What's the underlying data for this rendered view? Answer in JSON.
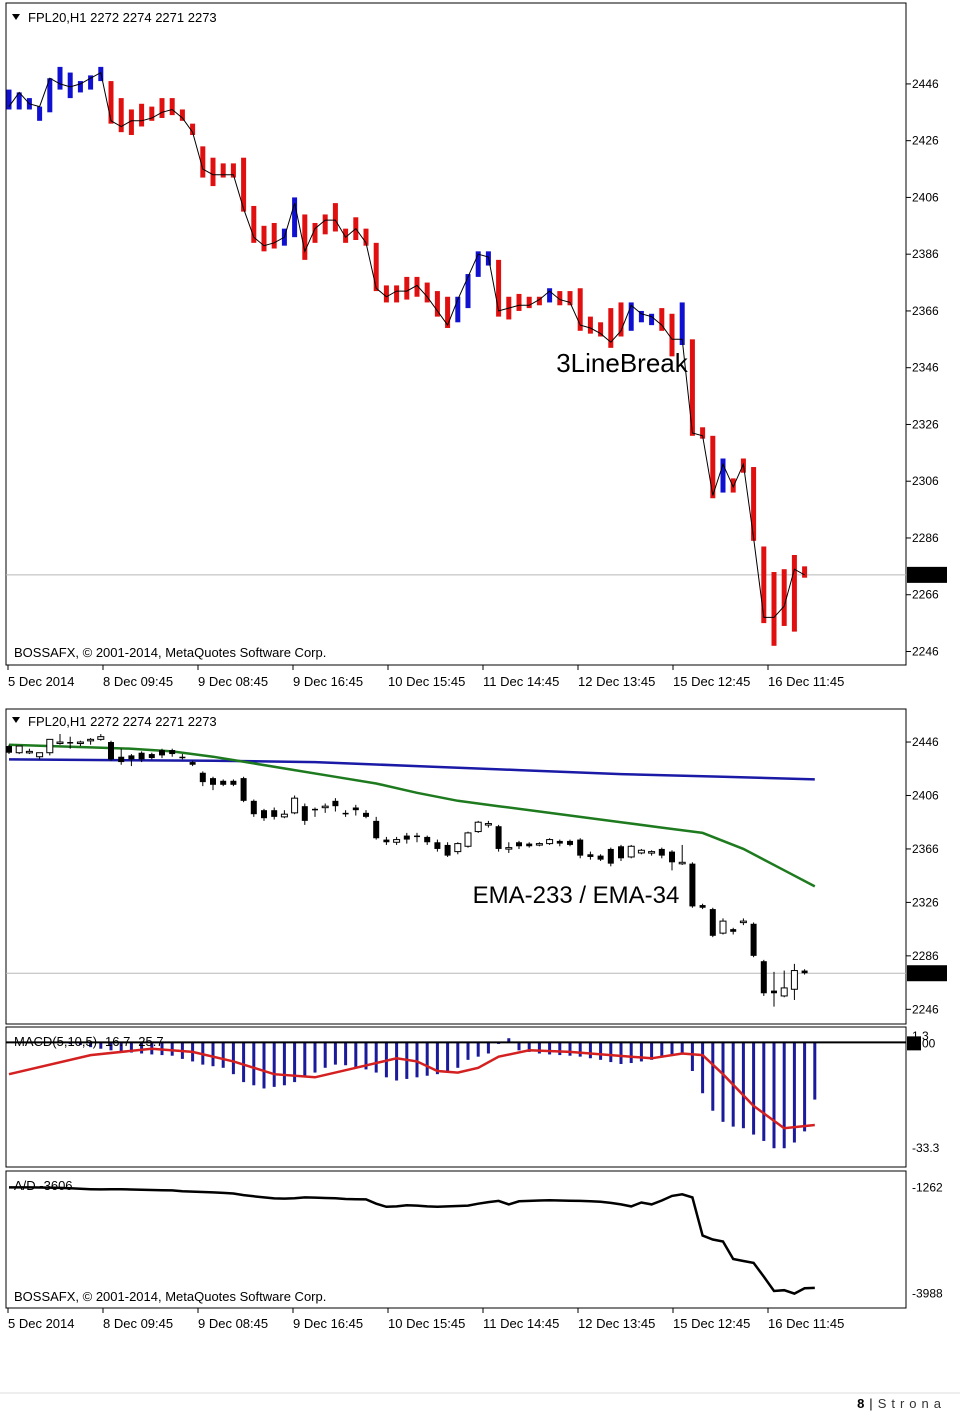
{
  "chart_data": [
    {
      "type": "candlestick",
      "panel": "top",
      "header": "FPL20,H1  2272 2274 2271 2273",
      "annotation": "3LineBreak",
      "copyright": "BOSSAFX, © 2001-2014, MetaQuotes Software Corp.",
      "price_axis_ticks": [
        "2446",
        "2426",
        "2406",
        "2386",
        "2366",
        "2346",
        "2326",
        "2306",
        "2286",
        "2266",
        "2246"
      ],
      "current_price_label": "2273",
      "current_price": 2273,
      "ylim": [
        2243,
        2465
      ],
      "time_labels": [
        "5 Dec 2014",
        "8 Dec 09:45",
        "9 Dec 08:45",
        "9 Dec 16:45",
        "10 Dec 15:45",
        "11 Dec 14:45",
        "12 Dec 13:45",
        "15 Dec 12:45",
        "16 Dec 11:45"
      ],
      "colors": {
        "up": "#1010d0",
        "down": "#e01010",
        "close_line": "#000000"
      },
      "bars": [
        [
          2443,
          2444,
          2437,
          2438,
          "up"
        ],
        [
          2438,
          2443,
          2437,
          2443,
          "up"
        ],
        [
          2439,
          2441,
          2437,
          2439,
          "up"
        ],
        [
          2435,
          2438,
          2433,
          2438,
          "up"
        ],
        [
          2438,
          2448,
          2436,
          2448,
          "up"
        ],
        [
          2446,
          2452,
          2444,
          2446,
          "up"
        ],
        [
          2446,
          2450,
          2441,
          2445,
          "up"
        ],
        [
          2445,
          2447,
          2443,
          2446,
          "up"
        ],
        [
          2447,
          2449,
          2444,
          2448,
          "up"
        ],
        [
          2448,
          2452,
          2447,
          2450,
          "up"
        ],
        [
          2446,
          2447,
          2432,
          2433,
          "down"
        ],
        [
          2435,
          2441,
          2429,
          2431,
          "down"
        ],
        [
          2436,
          2437,
          2428,
          2433,
          "down"
        ],
        [
          2438,
          2439,
          2431,
          2433,
          "down"
        ],
        [
          2437,
          2438,
          2433,
          2434,
          "down"
        ],
        [
          2440,
          2441,
          2434,
          2436,
          "down"
        ],
        [
          2440,
          2441,
          2435,
          2437,
          "down"
        ],
        [
          2435,
          2437,
          2433,
          2434,
          "down"
        ],
        [
          2431,
          2432,
          2428,
          2429,
          "down"
        ],
        [
          2423,
          2424,
          2413,
          2416,
          "down"
        ],
        [
          2419,
          2420,
          2410,
          2414,
          "down"
        ],
        [
          2417,
          2418,
          2413,
          2414,
          "down"
        ],
        [
          2417,
          2418,
          2413,
          2414,
          "down"
        ],
        [
          2419,
          2420,
          2401,
          2402,
          "down"
        ],
        [
          2402,
          2403,
          2390,
          2392,
          "down"
        ],
        [
          2395,
          2396,
          2387,
          2389,
          "down"
        ],
        [
          2395,
          2397,
          2388,
          2390,
          "down"
        ],
        [
          2390,
          2395,
          2389,
          2392,
          "up"
        ],
        [
          2393,
          2406,
          2392,
          2404,
          "up"
        ],
        [
          2398,
          2400,
          2384,
          2387,
          "down"
        ],
        [
          2396,
          2397,
          2390,
          2395,
          "down"
        ],
        [
          2397,
          2400,
          2393,
          2398,
          "down"
        ],
        [
          2402,
          2404,
          2394,
          2398,
          "down"
        ],
        [
          2393,
          2395,
          2390,
          2392,
          "down"
        ],
        [
          2397,
          2399,
          2391,
          2395,
          "down"
        ],
        [
          2393,
          2395,
          2389,
          2390,
          "down"
        ],
        [
          2387,
          2390,
          2373,
          2374,
          "down"
        ],
        [
          2373,
          2375,
          2369,
          2371,
          "down"
        ],
        [
          2371,
          2375,
          2369,
          2373,
          "down"
        ],
        [
          2376,
          2378,
          2370,
          2373,
          "down"
        ],
        [
          2376,
          2378,
          2371,
          2375,
          "down"
        ],
        [
          2375,
          2376,
          2369,
          2371,
          "down"
        ],
        [
          2371,
          2373,
          2364,
          2366,
          "down"
        ],
        [
          2369,
          2371,
          2360,
          2361,
          "down"
        ],
        [
          2364,
          2371,
          2362,
          2370,
          "up"
        ],
        [
          2368,
          2379,
          2367,
          2378,
          "up"
        ],
        [
          2379,
          2387,
          2378,
          2386,
          "up"
        ],
        [
          2384,
          2387,
          2382,
          2385,
          "up"
        ],
        [
          2383,
          2384,
          2364,
          2366,
          "down"
        ],
        [
          2366,
          2371,
          2363,
          2367,
          "down"
        ],
        [
          2371,
          2372,
          2366,
          2368,
          "down"
        ],
        [
          2370,
          2371,
          2367,
          2368,
          "down"
        ],
        [
          2370,
          2371,
          2368,
          2370,
          "down"
        ],
        [
          2370,
          2374,
          2369,
          2373,
          "up"
        ],
        [
          2372,
          2373,
          2368,
          2370,
          "down"
        ],
        [
          2372,
          2373,
          2368,
          2369,
          "down"
        ],
        [
          2373,
          2374,
          2359,
          2361,
          "down"
        ],
        [
          2362,
          2364,
          2358,
          2360,
          "down"
        ],
        [
          2361,
          2362,
          2357,
          2358,
          "down"
        ],
        [
          2366,
          2367,
          2353,
          2355,
          "down"
        ],
        [
          2368,
          2369,
          2357,
          2359,
          "down"
        ],
        [
          2360,
          2369,
          2359,
          2368,
          "up"
        ],
        [
          2363,
          2366,
          2362,
          2365,
          "up"
        ],
        [
          2363,
          2365,
          2361,
          2364,
          "up"
        ],
        [
          2366,
          2367,
          2359,
          2361,
          "down"
        ],
        [
          2364,
          2365,
          2350,
          2356,
          "down"
        ],
        [
          2355,
          2369,
          2354,
          2356,
          "up"
        ],
        [
          2355,
          2356,
          2322,
          2323,
          "down"
        ],
        [
          2324,
          2325,
          2321,
          2322,
          "down"
        ],
        [
          2321,
          2322,
          2300,
          2301,
          "down"
        ],
        [
          2303,
          2314,
          2302,
          2312,
          "up"
        ],
        [
          2306,
          2307,
          2302,
          2304,
          "down"
        ],
        [
          2311,
          2314,
          2309,
          2312,
          "down"
        ],
        [
          2310,
          2311,
          2285,
          2286,
          "down"
        ],
        [
          2282,
          2283,
          2256,
          2258,
          "down"
        ],
        [
          2260,
          2274,
          2248,
          2258,
          "down"
        ],
        [
          2256,
          2275,
          2255,
          2262,
          "down"
        ],
        [
          2261,
          2280,
          2253,
          2275,
          "down"
        ],
        [
          2275,
          2276,
          2272,
          2273,
          "down"
        ]
      ]
    },
    {
      "type": "candlestick",
      "panel": "middle",
      "header": "FPL20,H1  2272 2274 2271 2273",
      "annotation": "EMA-233 / EMA-34",
      "price_axis_ticks": [
        "2446",
        "2406",
        "2366",
        "2326",
        "2286",
        "2246"
      ],
      "current_price_label": "2273",
      "current_price": 2273,
      "ylim": [
        2238,
        2455
      ],
      "colors": {
        "candle": "#000000",
        "ema233": "#1a1aa6",
        "ema34": "#1e7a1e"
      },
      "ema233": [
        [
          0,
          2433
        ],
        [
          10,
          2432.5
        ],
        [
          20,
          2432
        ],
        [
          30,
          2431
        ],
        [
          40,
          2428
        ],
        [
          50,
          2425
        ],
        [
          60,
          2422
        ],
        [
          70,
          2420
        ],
        [
          79,
          2418
        ]
      ],
      "ema34": [
        [
          0,
          2444
        ],
        [
          8,
          2442
        ],
        [
          12,
          2441
        ],
        [
          16,
          2439
        ],
        [
          20,
          2435
        ],
        [
          24,
          2430
        ],
        [
          28,
          2425
        ],
        [
          32,
          2420
        ],
        [
          36,
          2415
        ],
        [
          40,
          2408
        ],
        [
          44,
          2402
        ],
        [
          48,
          2398
        ],
        [
          52,
          2394
        ],
        [
          56,
          2390
        ],
        [
          60,
          2386
        ],
        [
          64,
          2382
        ],
        [
          68,
          2378
        ],
        [
          72,
          2366
        ],
        [
          76,
          2350
        ],
        [
          79,
          2338
        ]
      ]
    },
    {
      "type": "bar",
      "panel": "macd",
      "header": "MACD(5,10,5) -16.7 -25.7",
      "axis_labels": [
        "1.3",
        "0.00",
        "-33.3"
      ],
      "ylim": [
        -37,
        2
      ],
      "colors": {
        "histogram": "#1a1a9a",
        "signal": "#d42020"
      },
      "histogram": [
        0,
        0,
        0,
        0,
        0,
        0.2,
        -0.5,
        -0.8,
        -1.5,
        -2,
        -2.5,
        -3,
        -3.2,
        -3.5,
        -3.8,
        -4,
        -4.2,
        -5.2,
        -6,
        -7,
        -7.5,
        -8,
        -10,
        -12.5,
        -13.5,
        -14.5,
        -14,
        -13.5,
        -12.5,
        -10.5,
        -9.5,
        -8,
        -7,
        -7.2,
        -8,
        -8.5,
        -9.5,
        -11,
        -12,
        -11.5,
        -11,
        -10.5,
        -10,
        -9,
        -8,
        -5.5,
        -4.5,
        -3.5,
        -0.5,
        1.3,
        -2.5,
        -3,
        -3.5,
        -3.8,
        -4,
        -4.2,
        -4.5,
        -5,
        -5.5,
        -6.2,
        -6.8,
        -6.5,
        -6,
        -5.5,
        -4.8,
        -4,
        -3.5,
        -9,
        -16,
        -21.5,
        -25,
        -26.5,
        -27,
        -29,
        -31,
        -33.3,
        -33.3,
        -31.5,
        -28,
        -18
      ],
      "signal": [
        [
          0,
          -10
        ],
        [
          8,
          -4
        ],
        [
          14,
          -2
        ],
        [
          18,
          -3
        ],
        [
          22,
          -6
        ],
        [
          26,
          -10
        ],
        [
          30,
          -11
        ],
        [
          34,
          -8
        ],
        [
          38,
          -5
        ],
        [
          40,
          -6
        ],
        [
          42,
          -9
        ],
        [
          44,
          -9.5
        ],
        [
          46,
          -8
        ],
        [
          48,
          -4.5
        ],
        [
          51,
          -2.5
        ],
        [
          55,
          -3
        ],
        [
          59,
          -4
        ],
        [
          63,
          -5
        ],
        [
          66,
          -3.5
        ],
        [
          68,
          -4
        ],
        [
          70,
          -10
        ],
        [
          73,
          -20
        ],
        [
          76,
          -27
        ],
        [
          79,
          -26
        ]
      ]
    },
    {
      "type": "line",
      "panel": "ad",
      "header": "A/D -3606",
      "copyright": "BOSSAFX, © 2001-2014, MetaQuotes Software Corp.",
      "axis_labels": [
        "-1262",
        "-3988"
      ],
      "ylim": [
        -4100,
        -1150
      ],
      "color": "#000000",
      "values": [
        -1262,
        -1262,
        -1262,
        -1265,
        -1268,
        -1275,
        -1285,
        -1300,
        -1310,
        -1315,
        -1310,
        -1312,
        -1318,
        -1325,
        -1330,
        -1335,
        -1340,
        -1360,
        -1370,
        -1380,
        -1390,
        -1405,
        -1420,
        -1460,
        -1490,
        -1520,
        -1545,
        -1550,
        -1540,
        -1520,
        -1525,
        -1535,
        -1540,
        -1560,
        -1565,
        -1570,
        -1680,
        -1760,
        -1750,
        -1720,
        -1730,
        -1750,
        -1760,
        -1750,
        -1740,
        -1730,
        -1680,
        -1640,
        -1610,
        -1700,
        -1620,
        -1610,
        -1600,
        -1595,
        -1600,
        -1605,
        -1610,
        -1620,
        -1630,
        -1660,
        -1700,
        -1750,
        -1650,
        -1700,
        -1600,
        -1480,
        -1440,
        -1520,
        -2500,
        -2600,
        -2650,
        -3100,
        -3150,
        -3200,
        -3550,
        -3920,
        -3900,
        -3988,
        -3850,
        -3840
      ],
      "time_labels": [
        "5 Dec 2014",
        "8 Dec 09:45",
        "9 Dec 08:45",
        "9 Dec 16:45",
        "10 Dec 15:45",
        "11 Dec 14:45",
        "12 Dec 13:45",
        "15 Dec 12:45",
        "16 Dec 11:45"
      ]
    }
  ],
  "footer": {
    "page": "8",
    "separator": "|",
    "word": "Strona"
  }
}
